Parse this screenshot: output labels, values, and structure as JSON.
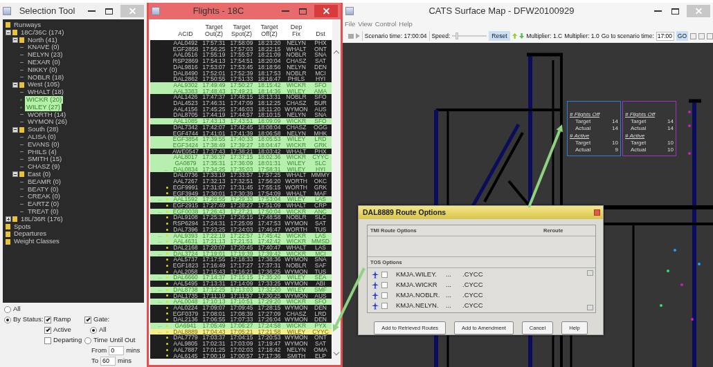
{
  "selection_tool": {
    "title": "Selection Tool",
    "tree": [
      {
        "label": "Runways",
        "kind": "folder",
        "selected": false
      },
      {
        "label": "18C/36C (174)",
        "kind": "folder",
        "expanded": true,
        "selected": false,
        "children": [
          {
            "label": "North (41)",
            "kind": "folder",
            "expanded": true,
            "selected": false,
            "children": [
              {
                "label": "KNAVE (0)",
                "kind": "leaf",
                "selected": false
              },
              {
                "label": "NELYN (23)",
                "kind": "leaf",
                "selected": false
              },
              {
                "label": "NEXAR (0)",
                "kind": "leaf",
                "selected": false
              },
              {
                "label": "NIKKY (0)",
                "kind": "leaf",
                "selected": false
              },
              {
                "label": "NOBLR (18)",
                "kind": "leaf",
                "selected": false
              }
            ]
          },
          {
            "label": "West (105)",
            "kind": "folder",
            "expanded": true,
            "selected": false,
            "children": [
              {
                "label": "WHALT (18)",
                "kind": "leaf",
                "selected": false
              },
              {
                "label": "WICKR (20)",
                "kind": "leaf",
                "selected": true
              },
              {
                "label": "WILEY (27)",
                "kind": "leaf",
                "selected": true
              },
              {
                "label": "WORTH (14)",
                "kind": "leaf",
                "selected": false
              },
              {
                "label": "WYMON (26)",
                "kind": "leaf",
                "selected": false
              }
            ]
          },
          {
            "label": "South (28)",
            "kind": "folder",
            "expanded": true,
            "selected": false,
            "children": [
              {
                "label": "ALISA (0)",
                "kind": "leaf",
                "selected": false
              },
              {
                "label": "EVANS (0)",
                "kind": "leaf",
                "selected": false
              },
              {
                "label": "PHILS (4)",
                "kind": "leaf",
                "selected": false
              },
              {
                "label": "SMITH (15)",
                "kind": "leaf",
                "selected": false
              },
              {
                "label": "CHASZ (9)",
                "kind": "leaf",
                "selected": false
              }
            ]
          },
          {
            "label": "East (0)",
            "kind": "folder",
            "expanded": true,
            "selected": false,
            "children": [
              {
                "label": "BEAMR (0)",
                "kind": "leaf",
                "selected": false
              },
              {
                "label": "BEATY (0)",
                "kind": "leaf",
                "selected": false
              },
              {
                "label": "CREAK (0)",
                "kind": "leaf",
                "selected": false
              },
              {
                "label": "EARTZ (0)",
                "kind": "leaf",
                "selected": false
              },
              {
                "label": "TREAT (0)",
                "kind": "leaf",
                "selected": false
              }
            ]
          }
        ]
      },
      {
        "label": "18L/36R (176)",
        "kind": "folder",
        "expanded": false,
        "selected": false
      },
      {
        "label": "Spots",
        "kind": "folder",
        "selected": false
      },
      {
        "label": "Departures",
        "kind": "folder",
        "selected": false
      },
      {
        "label": "Weight Classes",
        "kind": "folder",
        "selected": false
      }
    ],
    "filters": {
      "all": {
        "label": "All",
        "selected": false
      },
      "by_status": {
        "label": "By Status:",
        "selected": true
      },
      "ramp": {
        "label": "Ramp",
        "checked": true
      },
      "gate": {
        "label": "Gate:",
        "checked": true
      },
      "active": {
        "label": "Active",
        "checked": true
      },
      "gate_all": {
        "label": "All",
        "selected": true
      },
      "departing": {
        "label": "Departing",
        "checked": false
      },
      "time_until_out": {
        "label": "Time Until Out",
        "selected": false
      },
      "from": {
        "label": "From",
        "value": "0",
        "unit": "mins"
      },
      "to": {
        "label": "To",
        "value": "60",
        "unit": "mins"
      }
    }
  },
  "flights": {
    "title": "Flights - 18C",
    "columns": [
      "ACID",
      "Target Out(Z)",
      "Target Spot(Z)",
      "Target Off(Z)",
      "Dep Fix",
      "Dst"
    ],
    "rows": [
      {
        "cells": [
          "AAL0492",
          "17:57:31",
          "17:58:09",
          "18:23:20",
          "NELYN",
          "PHX"
        ],
        "highlighted": false,
        "selected": false,
        "dot": false
      },
      {
        "cells": [
          "EGF2858",
          "17:56:25",
          "17:57:03",
          "18:22:15",
          "WHALT",
          "ONT"
        ],
        "highlighted": false,
        "selected": false,
        "dot": false
      },
      {
        "cells": [
          "AAL0516",
          "17:55:19",
          "17:55:57",
          "18:21:09",
          "NOBLR",
          "SNA"
        ],
        "highlighted": false,
        "selected": false,
        "dot": false
      },
      {
        "cells": [
          "RSP2869",
          "17:54:13",
          "17:54:51",
          "18:20:04",
          "CHASZ",
          "SAT"
        ],
        "highlighted": false,
        "selected": false,
        "dot": false
      },
      {
        "cells": [
          "DAL9816",
          "17:53:07",
          "17:53:45",
          "18:18:56",
          "NELYN",
          "DEN"
        ],
        "highlighted": false,
        "selected": false,
        "dot": false
      },
      {
        "cells": [
          "DAL8490",
          "17:52:01",
          "17:52:39",
          "18:17:53",
          "NOBLR",
          "MCI"
        ],
        "highlighted": false,
        "selected": false,
        "dot": false
      },
      {
        "cells": [
          "DAL2862",
          "17:50:55",
          "17:51:33",
          "18:16:47",
          "PHILS",
          "HYI"
        ],
        "highlighted": false,
        "selected": false,
        "dot": false
      },
      {
        "cells": [
          "AAL9302",
          "17:49:49",
          "17:50:27",
          "18:15:42",
          "WICKR",
          "SFO"
        ],
        "highlighted": true,
        "selected": false,
        "dot": false
      },
      {
        "cells": [
          "AAL3383",
          "17:48:43",
          "17:49:21",
          "18:14:36",
          "WILEY",
          "AMA"
        ],
        "highlighted": true,
        "selected": false,
        "dot": false
      },
      {
        "cells": [
          "AAL1426",
          "17:47:37",
          "17:48:15",
          "18:13:31",
          "NOBLR",
          "SFO"
        ],
        "highlighted": false,
        "selected": false,
        "dot": false
      },
      {
        "cells": [
          "DAL4523",
          "17:46:31",
          "17:47:09",
          "18:12:25",
          "CHASZ",
          "BUR"
        ],
        "highlighted": false,
        "selected": false,
        "dot": false
      },
      {
        "cells": [
          "AAL4156",
          "17:45:25",
          "17:46:03",
          "18:11:20",
          "WYMON",
          "AUS"
        ],
        "highlighted": false,
        "selected": false,
        "dot": false
      },
      {
        "cells": [
          "DAL8705",
          "17:44:19",
          "17:44:57",
          "18:10:15",
          "NELYN",
          "SNA"
        ],
        "highlighted": false,
        "selected": false,
        "dot": false
      },
      {
        "cells": [
          "AAL1085",
          "17:43:13",
          "17:43:51",
          "18:09:09",
          "WICKR",
          "SFO"
        ],
        "highlighted": true,
        "selected": false,
        "dot": false
      },
      {
        "cells": [
          "DAL7342",
          "17:42:07",
          "17:42:45",
          "18:08:04",
          "CHASZ",
          "OGG"
        ],
        "highlighted": false,
        "selected": false,
        "dot": false
      },
      {
        "cells": [
          "EGF4744",
          "17:41:01",
          "17:41:39",
          "18:06:58",
          "NELYN",
          "MHK"
        ],
        "highlighted": false,
        "selected": false,
        "dot": false
      },
      {
        "cells": [
          "EGF3854",
          "17:39:55",
          "17:40:33",
          "18:05:53",
          "WILEY",
          "LRD"
        ],
        "highlighted": true,
        "selected": false,
        "dot": false
      },
      {
        "cells": [
          "EGF3424",
          "17:38:49",
          "17:39:27",
          "18:04:47",
          "WICKR",
          "GRK"
        ],
        "highlighted": true,
        "selected": false,
        "dot": false
      },
      {
        "cells": [
          "AWE0547",
          "17:37:43",
          "17:38:21",
          "18:03:42",
          "WHALT",
          "PHX"
        ],
        "highlighted": false,
        "selected": false,
        "dot": false
      },
      {
        "cells": [
          "AAL8017",
          "17:36:37",
          "17:37:15",
          "18:02:36",
          "WICKR",
          "CYYC"
        ],
        "highlighted": true,
        "selected": false,
        "dot": false
      },
      {
        "cells": [
          "GA0879",
          "17:35:31",
          "17:36:09",
          "18:01:31",
          "WILEY",
          "SLC"
        ],
        "highlighted": true,
        "selected": false,
        "dot": false
      },
      {
        "cells": [
          "DAL0834",
          "17:34:25",
          "17:35:03",
          "17:58:31",
          "WILEY",
          "HYI"
        ],
        "highlighted": true,
        "selected": false,
        "dot": false,
        "marker": "..."
      },
      {
        "cells": [
          "DAL0736",
          "17:33:19",
          "17:33:57",
          "17:57:25",
          "WHALT",
          "MMMY"
        ],
        "highlighted": false,
        "selected": false,
        "dot": false
      },
      {
        "cells": [
          "AAL7267",
          "17:32:13",
          "17:32:51",
          "17:56:20",
          "WORTH",
          "OKC"
        ],
        "highlighted": false,
        "selected": false,
        "dot": false
      },
      {
        "cells": [
          "EGF9991",
          "17:31:07",
          "17:31:45",
          "17:55:15",
          "WORTH",
          "GRK"
        ],
        "highlighted": false,
        "selected": false,
        "dot": true
      },
      {
        "cells": [
          "EGF3949",
          "17:30:01",
          "17:30:39",
          "17:54:09",
          "WHALT",
          "MAF"
        ],
        "highlighted": false,
        "selected": false,
        "dot": true
      },
      {
        "cells": [
          "AAL1592",
          "17:28:55",
          "17:29:33",
          "17:53:04",
          "WILEY",
          "LAS"
        ],
        "highlighted": true,
        "selected": false,
        "dot": true,
        "marker": "..."
      },
      {
        "cells": [
          "EGF2915",
          "17:27:49",
          "17:28:27",
          "17:51:09",
          "WHALT",
          "CRP"
        ],
        "highlighted": false,
        "selected": false,
        "dot": true
      },
      {
        "cells": [
          "EGF0038",
          "17:26:43",
          "17:27:21",
          "17:50:04",
          "WICKR",
          "ANC"
        ],
        "highlighted": true,
        "selected": false,
        "dot": true,
        "marker": "..."
      },
      {
        "cells": [
          "DAL9108",
          "17:25:37",
          "17:26:15",
          "17:48:58",
          "NOBLR",
          "SLC"
        ],
        "highlighted": false,
        "selected": false,
        "dot": true
      },
      {
        "cells": [
          "RSP6294",
          "17:24:31",
          "17:25:09",
          "17:47:53",
          "WYMON",
          "SAT"
        ],
        "highlighted": false,
        "selected": false,
        "dot": true
      },
      {
        "cells": [
          "DAL7396",
          "17:23:25",
          "17:24:03",
          "17:46:47",
          "WORTH",
          "TUS"
        ],
        "highlighted": false,
        "selected": false,
        "dot": true
      },
      {
        "cells": [
          "AAL9393",
          "17:22:19",
          "17:22:57",
          "17:45:42",
          "WICKR",
          "LAS"
        ],
        "highlighted": true,
        "selected": false,
        "dot": true,
        "marker": "..."
      },
      {
        "cells": [
          "AAL4631",
          "17:21:13",
          "17:21:51",
          "17:42:42",
          "WICKR",
          "MMSD"
        ],
        "highlighted": true,
        "selected": false,
        "dot": true,
        "marker": "..."
      },
      {
        "cells": [
          "DAL2168",
          "17:20:07",
          "17:20:45",
          "17:40:47",
          "WHALT",
          "LAS"
        ],
        "highlighted": false,
        "selected": false,
        "dot": true
      },
      {
        "cells": [
          "DAL3724",
          "17:19:01",
          "17:19:39",
          "17:39:42",
          "WICKR",
          "MCI"
        ],
        "highlighted": true,
        "selected": false,
        "dot": true,
        "marker": "..."
      },
      {
        "cells": [
          "AAL5737",
          "17:17:55",
          "17:18:33",
          "17:38:36",
          "WYMON",
          "SNA"
        ],
        "highlighted": false,
        "selected": false,
        "dot": true
      },
      {
        "cells": [
          "EGF1823",
          "17:16:49",
          "17:17:27",
          "17:37:31",
          "NOBLR",
          "SAF"
        ],
        "highlighted": false,
        "selected": false,
        "dot": true
      },
      {
        "cells": [
          "AAL2058",
          "17:15:43",
          "17:16:21",
          "17:36:25",
          "WYMON",
          "TUS"
        ],
        "highlighted": false,
        "selected": false,
        "dot": true
      },
      {
        "cells": [
          "DAL6660",
          "17:14:37",
          "17:15:15",
          "17:35:20",
          "WILEY",
          "SEA"
        ],
        "highlighted": true,
        "selected": false,
        "dot": true,
        "marker": "..."
      },
      {
        "cells": [
          "AAL5495",
          "17:13:31",
          "17:14:09",
          "17:33:25",
          "WYMON",
          "ABI"
        ],
        "highlighted": false,
        "selected": false,
        "dot": true
      },
      {
        "cells": [
          "DAL8738",
          "17:12:25",
          "17:13:03",
          "17:32:20",
          "WILEY",
          "SMF"
        ],
        "highlighted": true,
        "selected": false,
        "dot": true,
        "marker": "..."
      },
      {
        "cells": [
          "DAL1735",
          "17:11:19",
          "17:11:57",
          "17:30:25",
          "WYMON",
          "AUS"
        ],
        "highlighted": false,
        "selected": false,
        "dot": true
      },
      {
        "cells": [
          "AAL0048",
          "17:10:13",
          "17:10:51",
          "17:29:20",
          "WICKR",
          "SFO"
        ],
        "highlighted": true,
        "selected": false,
        "dot": true,
        "marker": "..."
      },
      {
        "cells": [
          "AAL0224",
          "17:09:07",
          "17:09:45",
          "17:28:15",
          "WYMON",
          "DEN"
        ],
        "highlighted": false,
        "selected": false,
        "dot": true
      },
      {
        "cells": [
          "EGF0379",
          "17:08:01",
          "17:08:39",
          "17:27:09",
          "CHASZ",
          "LRD"
        ],
        "highlighted": false,
        "selected": false,
        "dot": true
      },
      {
        "cells": [
          "DAL2136",
          "17:06:55",
          "17:07:33",
          "17:26:04",
          "WYMON",
          "DEN"
        ],
        "highlighted": false,
        "selected": false,
        "dot": true
      },
      {
        "cells": [
          "GA6941",
          "17:05:49",
          "17:06:27",
          "17:24:58",
          "WICKR",
          "PYX"
        ],
        "highlighted": true,
        "selected": false,
        "dot": true,
        "marker": "..."
      },
      {
        "cells": [
          "DAL8889",
          "17:04:43",
          "17:05:21",
          "17:21:58",
          "WILEY",
          "CYYC"
        ],
        "highlighted": true,
        "selected": true,
        "dot": true,
        "marker": "..."
      },
      {
        "cells": [
          "DAL7779",
          "17:03:37",
          "17:04:15",
          "17:20:53",
          "WYMON",
          "ONT"
        ],
        "highlighted": false,
        "selected": false,
        "dot": true
      },
      {
        "cells": [
          "AAL9805",
          "17:02:31",
          "17:03:09",
          "17:19:47",
          "WYMON",
          "SAT"
        ],
        "highlighted": false,
        "selected": false,
        "dot": true
      },
      {
        "cells": [
          "AAL7887",
          "17:01:25",
          "17:02:03",
          "17:18:42",
          "NELYN",
          "OMA"
        ],
        "highlighted": false,
        "selected": false,
        "dot": true
      },
      {
        "cells": [
          "AAL6145",
          "17:00:19",
          "17:00:57",
          "17:17:36",
          "SMITH",
          "ELP"
        ],
        "highlighted": false,
        "selected": false,
        "dot": true
      }
    ]
  },
  "surface_map": {
    "title": "CATS Surface Map - DFW20100929",
    "menu": [
      "File",
      "View",
      "Control",
      "Help"
    ],
    "toolbar": {
      "scenario_time": "Scenario time: 17:00:04",
      "speed": {
        "label": "Speed:",
        "level": 0.1
      },
      "reset": "Reset",
      "multipliers": [
        "Multiplier: 1.C",
        "Multiplier: 1.0"
      ],
      "goto_label": "Go to scenario time:",
      "goto_value": "17:00",
      "go": "GO"
    },
    "runway_panels": [
      {
        "color": "#2a7fd4",
        "sections": [
          {
            "title": "# Flights Off",
            "rows": [
              {
                "label": "Target",
                "value": "14"
              },
              {
                "label": "Actual",
                "value": "14"
              }
            ]
          },
          {
            "title": "# Active",
            "rows": [
              {
                "label": "Target",
                "value": "10"
              },
              {
                "label": "Actual",
                "value": "9"
              }
            ]
          }
        ]
      },
      {
        "color": "#a030c8",
        "sections": [
          {
            "title": "# Flights Off",
            "rows": [
              {
                "label": "Target",
                "value": "14"
              },
              {
                "label": "Actual",
                "value": "14"
              }
            ]
          },
          {
            "title": "# Active",
            "rows": [
              {
                "label": "Target",
                "value": "10"
              },
              {
                "label": "Actual",
                "value": "10"
              }
            ]
          }
        ]
      }
    ],
    "route_dialog": {
      "title": "DAL8889 Route Options",
      "tmi_header": "TMI Route Options",
      "reroute_header": "Reroute",
      "tos_header": "TOS Options",
      "routes": [
        {
          "fix": "KMJA.WILEY.",
          "gap": "...",
          "dest": ".CYCC",
          "checked": false
        },
        {
          "fix": "KMJA.WICKR",
          "gap": "...",
          "dest": ".CYCC",
          "checked": false
        },
        {
          "fix": "KMJA.NOBLR.",
          "gap": "...",
          "dest": ".CYCC",
          "checked": false
        },
        {
          "fix": "KMJA.NELYN.",
          "gap": "...",
          "dest": ".CYCC",
          "checked": false
        }
      ],
      "buttons": [
        "Add to Retrieved Routes",
        "Add to Amendment",
        "Cancel",
        "Help"
      ]
    }
  }
}
